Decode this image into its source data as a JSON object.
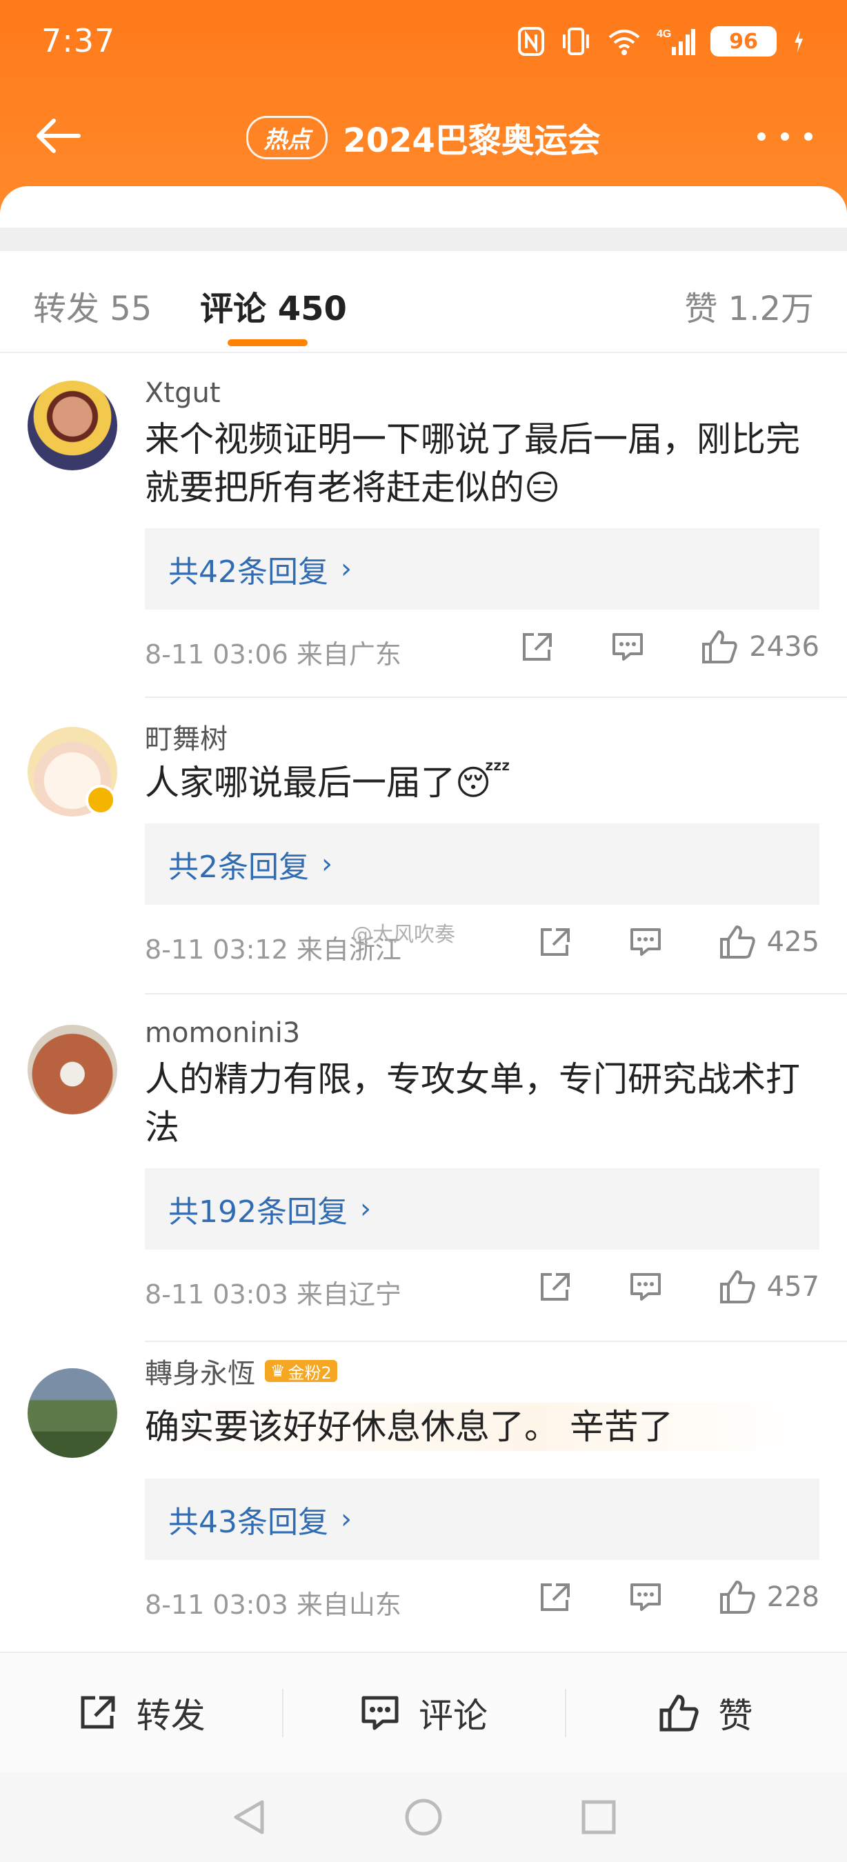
{
  "status_bar": {
    "time": "7:37",
    "battery": "96"
  },
  "nav": {
    "hot_tag": "热点",
    "title": "2024巴黎奥运会"
  },
  "tabs": {
    "repost": "转发 55",
    "comments": "评论 450",
    "likes": "赞 1.2万"
  },
  "comments": [
    {
      "user": "Xtgut",
      "text": "来个视频证明一下哪说了最后一届，刚比完就要把所有老将赶走似的😑",
      "replies": "共42条回复",
      "time": "8-11 03:06 来自广东",
      "likes": "2436"
    },
    {
      "user": "町舞树",
      "text": "人家哪说最后一届了😴",
      "replies": "共2条回复",
      "time": "8-11 03:12 来自浙江",
      "likes": "425"
    },
    {
      "user": "momonini3",
      "text": "人的精力有限，专攻女单，专门研究战术打法",
      "replies": "共192条回复",
      "time": "8-11 03:03 来自辽宁",
      "likes": "457"
    },
    {
      "user": "轉身永恆",
      "badge": "金粉2",
      "text": "确实要该好好休息休息了。 辛苦了",
      "replies": "共43条回复",
      "time": "8-11 03:03 来自山东",
      "likes": "228"
    }
  ],
  "watermark": "@大风吹奏",
  "bottom_bar": {
    "repost": "转发",
    "comment": "评论",
    "like": "赞"
  },
  "colors": {
    "header": "#ff7a1a",
    "accent": "#ff8200",
    "link": "#2f6cb3"
  }
}
